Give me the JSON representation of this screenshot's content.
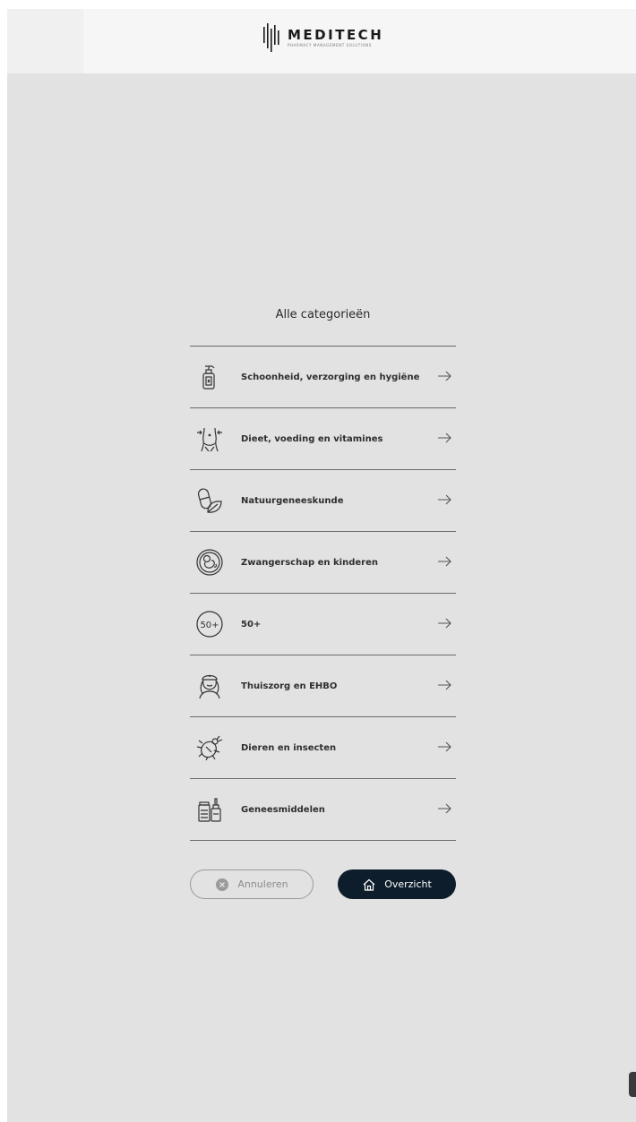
{
  "header": {
    "logo_name": "MEDITECH",
    "logo_tagline": "PHARMACY MANAGEMENT SOLUTIONS"
  },
  "panel": {
    "title": "Alle categorieën",
    "categories": [
      {
        "label": "Schoonheid, verzorging en hygiëne",
        "icon": "soap-bottle-icon"
      },
      {
        "label": "Dieet, voeding en vitamines",
        "icon": "waist-measure-icon"
      },
      {
        "label": "Natuurgeneeskunde",
        "icon": "pill-leaf-icon"
      },
      {
        "label": "Zwangerschap en kinderen",
        "icon": "baby-in-womb-icon"
      },
      {
        "label": "50+",
        "icon": "fifty-plus-icon"
      },
      {
        "label": "Thuiszorg en EHBO",
        "icon": "nurse-icon"
      },
      {
        "label": "Dieren en insecten",
        "icon": "tick-bug-icon"
      },
      {
        "label": "Geneesmiddelen",
        "icon": "medicine-bottles-icon"
      }
    ]
  },
  "fifty_icon_text": "50+",
  "actions": {
    "cancel_label": "Annuleren",
    "overview_label": "Overzicht"
  },
  "colors": {
    "background": "#e2e2e2",
    "header": "#f6f6f6",
    "primary_button": "#0e1d2b",
    "divider": "#6a6a6a"
  }
}
